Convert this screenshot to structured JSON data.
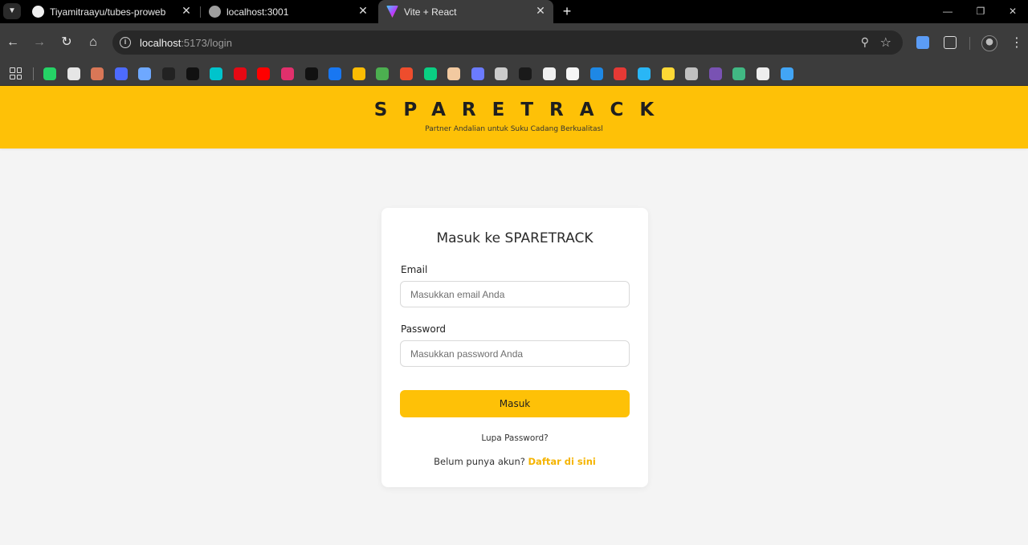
{
  "browser": {
    "tabs": [
      {
        "title": "Tiyamitraayu/tubes-proweb",
        "icon": "github-icon",
        "active": false
      },
      {
        "title": "localhost:3001",
        "icon": "globe-icon",
        "active": false
      },
      {
        "title": "Vite + React",
        "icon": "vite-icon",
        "active": true
      }
    ],
    "url_host": "localhost",
    "url_path": ":5173/login",
    "bookmarks": [
      {
        "icon": "whatsapp-icon",
        "color": "#25d366"
      },
      {
        "icon": "openai-icon",
        "color": "#e6e6e6"
      },
      {
        "icon": "claude-icon",
        "color": "#d97757"
      },
      {
        "icon": "deepseek-icon",
        "color": "#4d6bfe"
      },
      {
        "icon": "gemini-icon",
        "color": "#6ea8ff"
      },
      {
        "icon": "perplexity-icon",
        "color": "#222222"
      },
      {
        "icon": "grok-icon",
        "color": "#111111"
      },
      {
        "icon": "canva-icon",
        "color": "#00c4cc"
      },
      {
        "icon": "netflix-icon",
        "color": "#e50914"
      },
      {
        "icon": "youtube-icon",
        "color": "#ff0000"
      },
      {
        "icon": "instagram-icon",
        "color": "#e1306c"
      },
      {
        "icon": "tiktok-icon",
        "color": "#111111"
      },
      {
        "icon": "facebook-icon",
        "color": "#1877f2"
      },
      {
        "icon": "google-drive-icon",
        "color": "#fbbc04"
      },
      {
        "icon": "edlink-icon",
        "color": "#4caf50"
      },
      {
        "icon": "shop-icon",
        "color": "#ee4d2d"
      },
      {
        "icon": "figma-icon",
        "color": "#0acf83"
      },
      {
        "icon": "photo-app-icon",
        "color": "#f2c9a0"
      },
      {
        "icon": "loader-icon",
        "color": "#6b7bff"
      },
      {
        "icon": "notes-icon",
        "color": "#cccccc"
      },
      {
        "icon": "dashboard-icon",
        "color": "#1a1a1a"
      },
      {
        "icon": "github-bookmark-icon",
        "color": "#f0f0f0"
      },
      {
        "icon": "document-icon",
        "color": "#f5f5f5"
      },
      {
        "icon": "kk-icon",
        "color": "#1e88e5"
      },
      {
        "icon": "heart-icon",
        "color": "#e53935"
      },
      {
        "icon": "calendar-icon",
        "color": "#29b6f6"
      },
      {
        "icon": "image-icon",
        "color": "#fdd835"
      },
      {
        "icon": "donut-icon",
        "color": "#c0c0c0"
      },
      {
        "icon": "bootstrap-icon",
        "color": "#7952b3"
      },
      {
        "icon": "vue-icon",
        "color": "#41b883"
      },
      {
        "icon": "person-icon",
        "color": "#eeeeee"
      },
      {
        "icon": "flutter-icon",
        "color": "#42a5f5"
      }
    ]
  },
  "header": {
    "brand": "SPARETRACK",
    "tagline": "Partner Andalian untuk Suku Cadang Berkualitasl"
  },
  "login": {
    "title": "Masuk ke SPARETRACK",
    "email_label": "Email",
    "email_placeholder": "Masukkan email Anda",
    "password_label": "Password",
    "password_placeholder": "Masukkan password Anda",
    "submit_label": "Masuk",
    "forgot_label": "Lupa Password?",
    "register_prompt": "Belum punya akun?",
    "register_link": "Daftar di sini"
  },
  "colors": {
    "accent": "#fec107",
    "link": "#f5b400",
    "page_bg": "#f4f4f4"
  }
}
